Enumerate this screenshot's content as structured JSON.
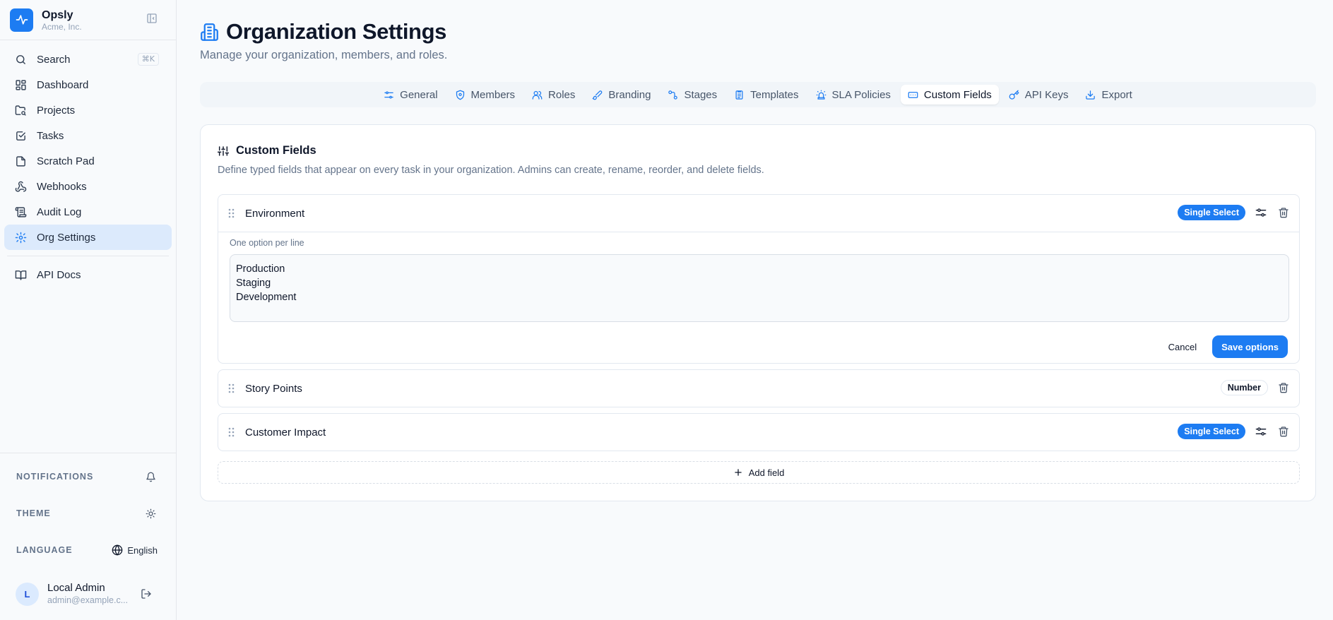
{
  "brand": {
    "name": "Opsly",
    "org": "Acme, Inc."
  },
  "sidebar": {
    "search": {
      "label": "Search",
      "shortcut": "⌘K"
    },
    "items": [
      {
        "label": "Dashboard",
        "icon": "dashboard-icon"
      },
      {
        "label": "Projects",
        "icon": "folder-search-icon"
      },
      {
        "label": "Tasks",
        "icon": "checkbox-icon"
      },
      {
        "label": "Scratch Pad",
        "icon": "sticky-note-icon"
      },
      {
        "label": "Webhooks",
        "icon": "webhook-icon"
      },
      {
        "label": "Audit Log",
        "icon": "scroll-icon"
      },
      {
        "label": "Org Settings",
        "icon": "gear-icon",
        "active": true
      }
    ],
    "api_docs": "API Docs",
    "notifications_label": "NOTIFICATIONS",
    "theme_label": "THEME",
    "language_label": "LANGUAGE",
    "language_value": "English",
    "user": {
      "initial": "L",
      "name": "Local Admin",
      "email": "admin@example.c..."
    }
  },
  "page": {
    "title": "Organization Settings",
    "subtitle": "Manage your organization, members, and roles."
  },
  "tabs": [
    {
      "label": "General",
      "icon": "sliders-icon"
    },
    {
      "label": "Members",
      "icon": "shield-icon"
    },
    {
      "label": "Roles",
      "icon": "users-icon"
    },
    {
      "label": "Branding",
      "icon": "brush-icon"
    },
    {
      "label": "Stages",
      "icon": "workflow-icon"
    },
    {
      "label": "Templates",
      "icon": "clipboard-list-icon"
    },
    {
      "label": "SLA Policies",
      "icon": "siren-icon"
    },
    {
      "label": "Custom Fields",
      "icon": "rectangle-ellipsis-icon",
      "active": true
    },
    {
      "label": "API Keys",
      "icon": "key-icon"
    },
    {
      "label": "Export",
      "icon": "download-icon"
    }
  ],
  "custom_fields": {
    "title": "Custom Fields",
    "description": "Define typed fields that appear on every task in your organization. Admins can create, rename, reorder, and delete fields.",
    "fields": [
      {
        "name": "Environment",
        "type": "Single Select",
        "expanded": true,
        "options_hint": "One option per line",
        "options_text": "Production\nStaging\nDevelopment",
        "cancel_label": "Cancel",
        "save_label": "Save options"
      },
      {
        "name": "Story Points",
        "type": "Number"
      },
      {
        "name": "Customer Impact",
        "type": "Single Select"
      }
    ],
    "add_label": "Add field"
  },
  "colors": {
    "accent": "#1d7cf2",
    "active_nav_bg": "#dceafc"
  }
}
